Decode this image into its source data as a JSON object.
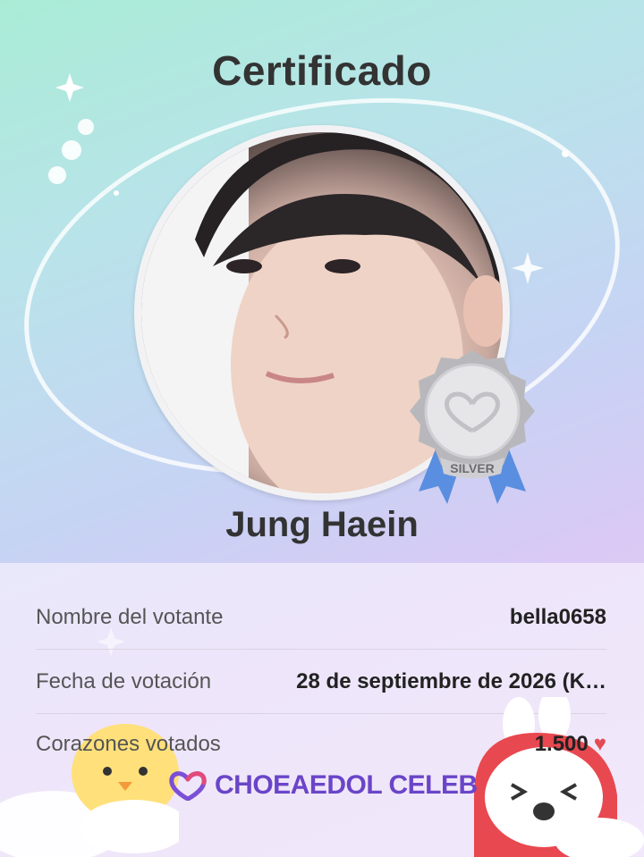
{
  "certificate": {
    "title": "Certificado",
    "celebrity_name": "Jung Haein",
    "badge": {
      "tier": "SILVER",
      "icon": "heart-logo-icon"
    }
  },
  "details": [
    {
      "label": "Nombre del votante",
      "value": "bella0658"
    },
    {
      "label": "Fecha de votación",
      "value": "28 de septiembre de 2026 (K…"
    },
    {
      "label": "Corazones votados",
      "value": "1.500",
      "icon": "heart-icon"
    }
  ],
  "brand": {
    "name": "CHOEAEDOL CELEB"
  },
  "colors": {
    "brand": "#6a45c8",
    "heart": "#e34a55",
    "silver": "#c9c9cc",
    "ribbon": "#5a8ee0"
  }
}
